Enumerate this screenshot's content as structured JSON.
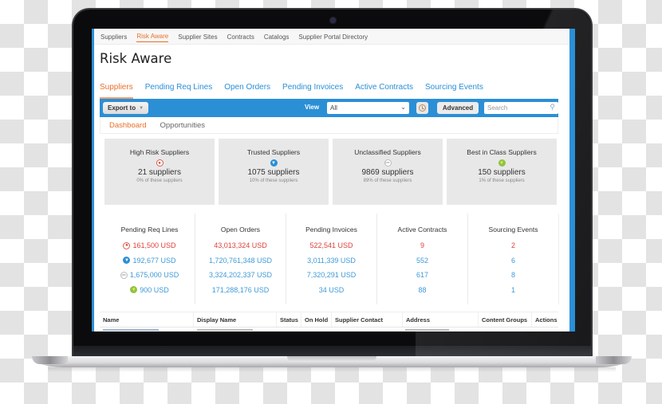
{
  "colors": {
    "accent_orange": "#e8702a",
    "brand_blue": "#2b8fd6",
    "risk_red": "#e0413a",
    "link_blue": "#3f9ad8"
  },
  "top_nav": {
    "items": [
      {
        "label": "Suppliers",
        "active": false
      },
      {
        "label": "Risk Aware",
        "active": true
      },
      {
        "label": "Supplier Sites",
        "active": false
      },
      {
        "label": "Contracts",
        "active": false
      },
      {
        "label": "Catalogs",
        "active": false
      },
      {
        "label": "Supplier Portal Directory",
        "active": false
      }
    ]
  },
  "page_title": "Risk Aware",
  "sub_tabs": [
    {
      "label": "Suppliers",
      "active": true
    },
    {
      "label": "Pending Req Lines",
      "active": false
    },
    {
      "label": "Open Orders",
      "active": false
    },
    {
      "label": "Pending Invoices",
      "active": false
    },
    {
      "label": "Active Contracts",
      "active": false
    },
    {
      "label": "Sourcing Events",
      "active": false
    }
  ],
  "toolbar": {
    "export_label": "Export to",
    "view_label": "View",
    "view_value": "All",
    "advanced_label": "Advanced",
    "search_placeholder": "Search",
    "icons": {
      "export_chevron": "chevron-down-icon",
      "view_chevron": "chevron-down-icon",
      "history": "clock-icon",
      "search": "search-icon"
    }
  },
  "dashboard_tabs": [
    {
      "label": "Dashboard",
      "active": true
    },
    {
      "label": "Opportunities",
      "active": false
    }
  ],
  "cards": [
    {
      "title": "High Risk Suppliers",
      "icon": "fire-icon",
      "count": "21 suppliers",
      "pct": "0% of these suppliers"
    },
    {
      "title": "Trusted Suppliers",
      "icon": "trophy-icon",
      "count": "1075 suppliers",
      "pct": "10% of these suppliers"
    },
    {
      "title": "Unclassified Suppliers",
      "icon": "chart-icon",
      "count": "9869 suppliers",
      "pct": "89% of these suppliers"
    },
    {
      "title": "Best in Class Suppliers",
      "icon": "trophy-gold-icon",
      "count": "150 suppliers",
      "pct": "1% of these suppliers"
    }
  ],
  "metrics": {
    "columns": [
      {
        "header": "Pending Req Lines",
        "values": [
          "161,500 USD",
          "192,677 USD",
          "1,675,000 USD",
          "900 USD"
        ]
      },
      {
        "header": "Open Orders",
        "values": [
          "43,013,324 USD",
          "1,720,761,348 USD",
          "3,324,202,337 USD",
          "171,288,176 USD"
        ]
      },
      {
        "header": "Pending Invoices",
        "values": [
          "522,541 USD",
          "3,011,339 USD",
          "7,320,291 USD",
          "34 USD"
        ]
      },
      {
        "header": "Active Contracts",
        "values": [
          "9",
          "552",
          "617",
          "88"
        ]
      },
      {
        "header": "Sourcing Events",
        "values": [
          "2",
          "6",
          "8",
          "1"
        ]
      }
    ],
    "row_categories": [
      "High Risk",
      "Trusted",
      "Unclassified",
      "Best in Class"
    ]
  },
  "table": {
    "headers": [
      "Name",
      "Display Name",
      "Status",
      "On Hold",
      "Supplier Contact",
      "Address",
      "Content Groups",
      "Actions"
    ]
  }
}
